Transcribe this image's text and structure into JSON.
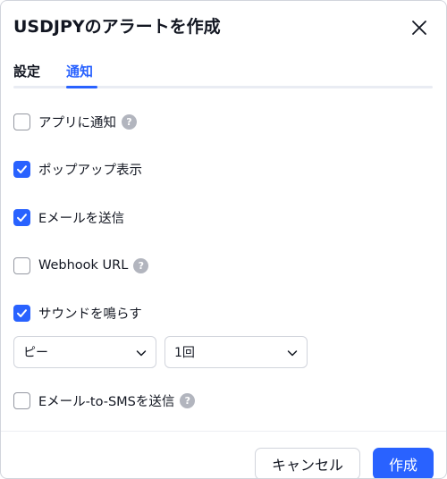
{
  "dialog": {
    "title": "USDJPYのアラートを作成",
    "tabs": [
      {
        "label": "設定",
        "active": false
      },
      {
        "label": "通知",
        "active": true
      }
    ]
  },
  "options": [
    {
      "label": "アプリに通知",
      "checked": false,
      "help": true
    },
    {
      "label": "ポップアップ表示",
      "checked": true,
      "help": false
    },
    {
      "label": "Eメールを送信",
      "checked": true,
      "help": false
    },
    {
      "label": "Webhook URL",
      "checked": false,
      "help": true
    },
    {
      "label": "サウンドを鳴らす",
      "checked": true,
      "help": false
    }
  ],
  "sound": {
    "tone_value": "ピー",
    "repeat_value": "1回"
  },
  "sms_option": {
    "label": "Eメール-to-SMSを送信",
    "checked": false,
    "help": true
  },
  "help_glyph": "?",
  "footer": {
    "cancel_label": "キャンセル",
    "create_label": "作成"
  },
  "colors": {
    "accent": "#2962ff",
    "text": "#131722",
    "border": "#d1d4dc",
    "help_icon": "#b2b5be"
  },
  "icons": {
    "close": "close-icon",
    "check": "checkmark-icon",
    "help": "question-circle-icon",
    "dropdown": "chevron-down-icon"
  }
}
